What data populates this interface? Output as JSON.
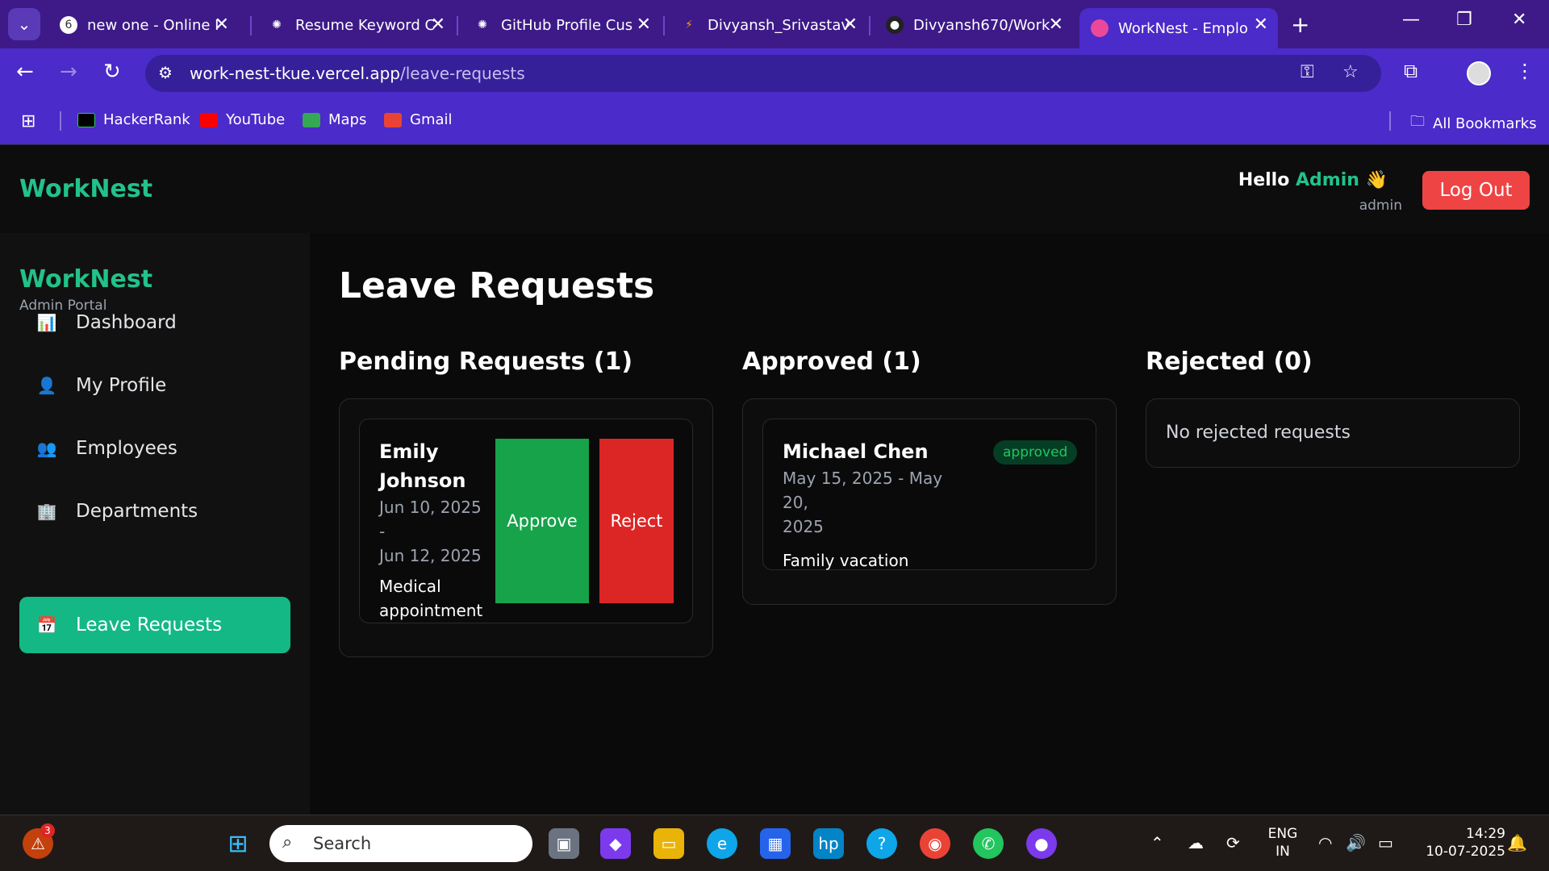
{
  "browser": {
    "tabs": [
      {
        "label": "new one - Online I",
        "active": false
      },
      {
        "label": "Resume Keyword C",
        "active": false
      },
      {
        "label": "GitHub Profile Cus",
        "active": false
      },
      {
        "label": "Divyansh_Srivastav",
        "active": false
      },
      {
        "label": "Divyansh670/Work",
        "active": false
      },
      {
        "label": "WorkNest - Emplo",
        "active": true
      }
    ],
    "url_host": "work-nest-tkue.vercel.app",
    "url_path": "/leave-requests",
    "bookmarks": [
      "HackerRank",
      "YouTube",
      "Maps",
      "Gmail"
    ],
    "all_bookmarks": "All Bookmarks"
  },
  "header": {
    "brand": "WorkNest",
    "hello_prefix": "Hello",
    "hello_user": "Admin",
    "hello_emoji": "👋",
    "role": "admin",
    "logout_label": "Log Out"
  },
  "sidebar": {
    "brand": "WorkNest",
    "subtitle": "Admin Portal",
    "items": [
      {
        "label": "Dashboard",
        "icon": "chart-icon",
        "glyph": "📊"
      },
      {
        "label": "My Profile",
        "icon": "person-icon",
        "glyph": "👤"
      },
      {
        "label": "Employees",
        "icon": "people-icon",
        "glyph": "👥"
      },
      {
        "label": "Departments",
        "icon": "building-icon",
        "glyph": "🏢"
      },
      {
        "label": "Leave Requests",
        "icon": "calendar-icon",
        "glyph": "📅"
      }
    ]
  },
  "main": {
    "title": "Leave Requests",
    "pending": {
      "title": "Pending Requests (1)",
      "card": {
        "name_line1": "Emily",
        "name_line2": "Johnson",
        "date_line1": "Jun 10, 2025 -",
        "date_line2": "Jun 12, 2025",
        "reason_line1": "Medical",
        "reason_line2": "appointment",
        "approve_label": "Approve",
        "reject_label": "Reject"
      }
    },
    "approved": {
      "title": "Approved (1)",
      "card": {
        "name": "Michael Chen",
        "date_line1": "May 15, 2025 - May 20,",
        "date_line2": "2025",
        "reason": "Family vacation",
        "badge": "approved"
      }
    },
    "rejected": {
      "title": "Rejected (0)",
      "empty": "No rejected requests"
    }
  },
  "taskbar": {
    "notification_count": "3",
    "search_placeholder": "Search",
    "language_line1": "ENG",
    "language_line2": "IN",
    "time": "14:29",
    "date": "10-07-2025"
  },
  "colors": {
    "accent_green": "#22c28a",
    "active_nav": "#14b885",
    "approve": "#16a34a",
    "reject": "#dc2626",
    "logout": "#ef4444",
    "chrome_purple": "#4b2bc9"
  }
}
